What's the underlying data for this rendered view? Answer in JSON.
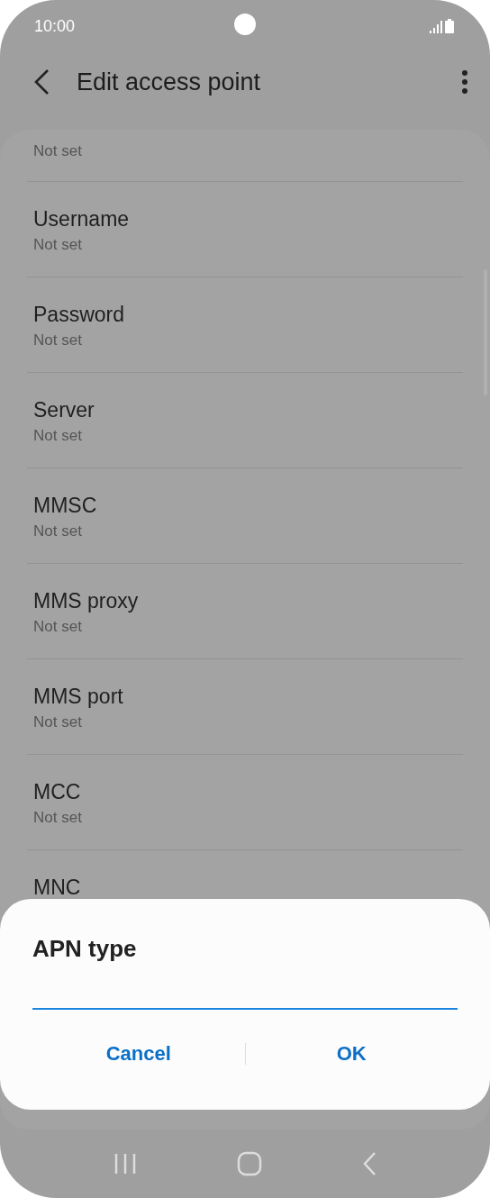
{
  "status_bar": {
    "time": "10:00"
  },
  "header": {
    "title": "Edit access point"
  },
  "settings": [
    {
      "value": "Not set"
    },
    {
      "title": "Username",
      "value": "Not set"
    },
    {
      "title": "Password",
      "value": "Not set"
    },
    {
      "title": "Server",
      "value": "Not set"
    },
    {
      "title": "MMSC",
      "value": "Not set"
    },
    {
      "title": "MMS proxy",
      "value": "Not set"
    },
    {
      "title": "MMS port",
      "value": "Not set"
    },
    {
      "title": "MCC",
      "value": "Not set"
    },
    {
      "title": "MNC"
    }
  ],
  "dialog": {
    "title": "APN type",
    "buttons": [
      "Cancel",
      "OK"
    ]
  }
}
